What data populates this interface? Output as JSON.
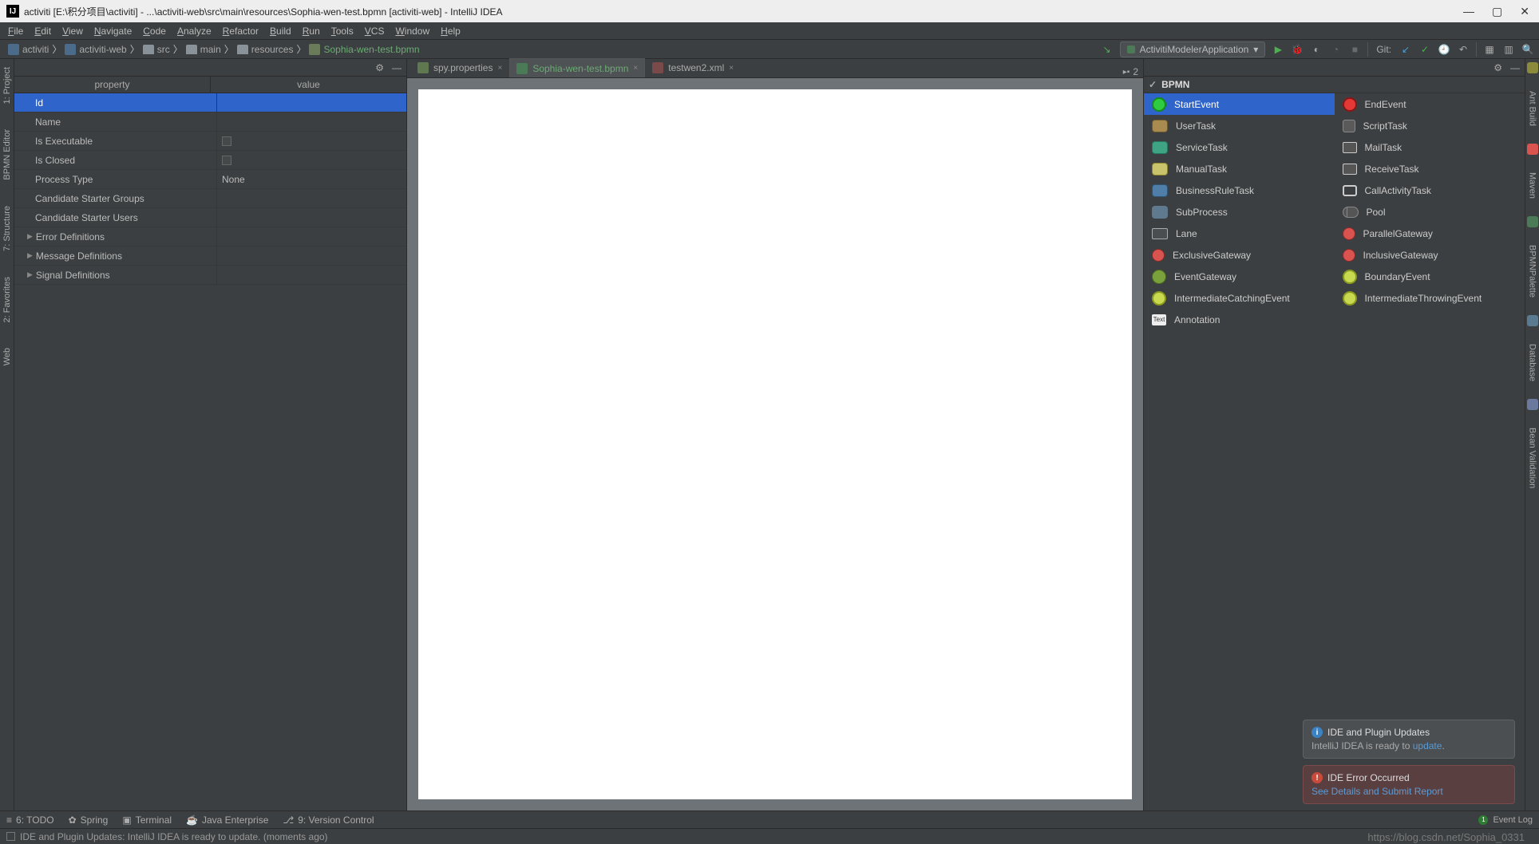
{
  "titlebar": {
    "icon_text": "IJ",
    "title": "activiti [E:\\积分项目\\activiti] - ...\\activiti-web\\src\\main\\resources\\Sophia-wen-test.bpmn [activiti-web] - IntelliJ IDEA"
  },
  "menubar": [
    "File",
    "Edit",
    "View",
    "Navigate",
    "Code",
    "Analyze",
    "Refactor",
    "Build",
    "Run",
    "Tools",
    "VCS",
    "Window",
    "Help"
  ],
  "breadcrumbs": [
    {
      "label": "activiti",
      "type": "mod"
    },
    {
      "label": "activiti-web",
      "type": "mod"
    },
    {
      "label": "src",
      "type": "folder"
    },
    {
      "label": "main",
      "type": "folder"
    },
    {
      "label": "resources",
      "type": "folder"
    },
    {
      "label": "Sophia-wen-test.bpmn",
      "type": "file",
      "active": true
    }
  ],
  "run_config": "ActivitiModelerApplication",
  "git_label": "Git:",
  "left_tabs": [
    "1: Project",
    "BPMN Editor",
    "7: Structure",
    "2: Favorites",
    "Web"
  ],
  "right_tabs": [
    "Ant Build",
    "Maven",
    "BPMNPalette",
    "Database",
    "Bean Validation"
  ],
  "prop_panel": {
    "cols": [
      "property",
      "value"
    ],
    "rows": [
      {
        "k": "Id",
        "v": "",
        "sel": true
      },
      {
        "k": "Name",
        "v": ""
      },
      {
        "k": "Is Executable",
        "v": "",
        "check": true
      },
      {
        "k": "Is Closed",
        "v": "",
        "check": true
      },
      {
        "k": "Process Type",
        "v": "None"
      },
      {
        "k": "Candidate Starter Groups",
        "v": ""
      },
      {
        "k": "Candidate Starter Users",
        "v": ""
      },
      {
        "k": "Error Definitions",
        "v": "",
        "exp": true
      },
      {
        "k": "Message Definitions",
        "v": "",
        "exp": true
      },
      {
        "k": "Signal Definitions",
        "v": "",
        "exp": true
      }
    ]
  },
  "tabs": [
    {
      "label": "spy.properties",
      "icon": "prop"
    },
    {
      "label": "Sophia-wen-test.bpmn",
      "icon": "bpmn",
      "active": true
    },
    {
      "label": "testwen2.xml",
      "icon": "xml"
    }
  ],
  "split_label": "2",
  "palette": {
    "title": "BPMN",
    "items": [
      {
        "label": "StartEvent",
        "icon": "ev-start",
        "sel": true
      },
      {
        "label": "EndEvent",
        "icon": "ev-end"
      },
      {
        "label": "UserTask",
        "icon": "task"
      },
      {
        "label": "ScriptTask",
        "icon": "script"
      },
      {
        "label": "ServiceTask",
        "icon": "task teal"
      },
      {
        "label": "MailTask",
        "icon": "mail"
      },
      {
        "label": "ManualTask",
        "icon": "task yel"
      },
      {
        "label": "ReceiveTask",
        "icon": "recv"
      },
      {
        "label": "BusinessRuleTask",
        "icon": "task blue"
      },
      {
        "label": "CallActivityTask",
        "icon": "call"
      },
      {
        "label": "SubProcess",
        "icon": "sub"
      },
      {
        "label": "Pool",
        "icon": "pool"
      },
      {
        "label": "Lane",
        "icon": "lane"
      },
      {
        "label": "ParallelGateway",
        "icon": "gw"
      },
      {
        "label": "ExclusiveGateway",
        "icon": "gw"
      },
      {
        "label": "InclusiveGateway",
        "icon": "gw"
      },
      {
        "label": "EventGateway",
        "icon": "gw green"
      },
      {
        "label": "BoundaryEvent",
        "icon": "bd"
      },
      {
        "label": "IntermediateCatchingEvent",
        "icon": "bd"
      },
      {
        "label": "IntermediateThrowingEvent",
        "icon": "bd"
      },
      {
        "label": "Annotation",
        "icon": "ann"
      }
    ]
  },
  "notifs": [
    {
      "type": "info",
      "title": "IDE and Plugin Updates",
      "body_pre": "IntelliJ IDEA is ready to ",
      "link": "update",
      "body_post": "."
    },
    {
      "type": "error",
      "title": "IDE Error Occurred",
      "link": "See Details and Submit Report"
    }
  ],
  "bottombar": [
    "6: TODO",
    "Spring",
    "Terminal",
    "Java Enterprise",
    "9: Version Control"
  ],
  "event_log": "Event Log",
  "status": "IDE and Plugin Updates: IntelliJ IDEA is ready to update. (moments ago)",
  "watermark": "https://blog.csdn.net/Sophia_0331"
}
